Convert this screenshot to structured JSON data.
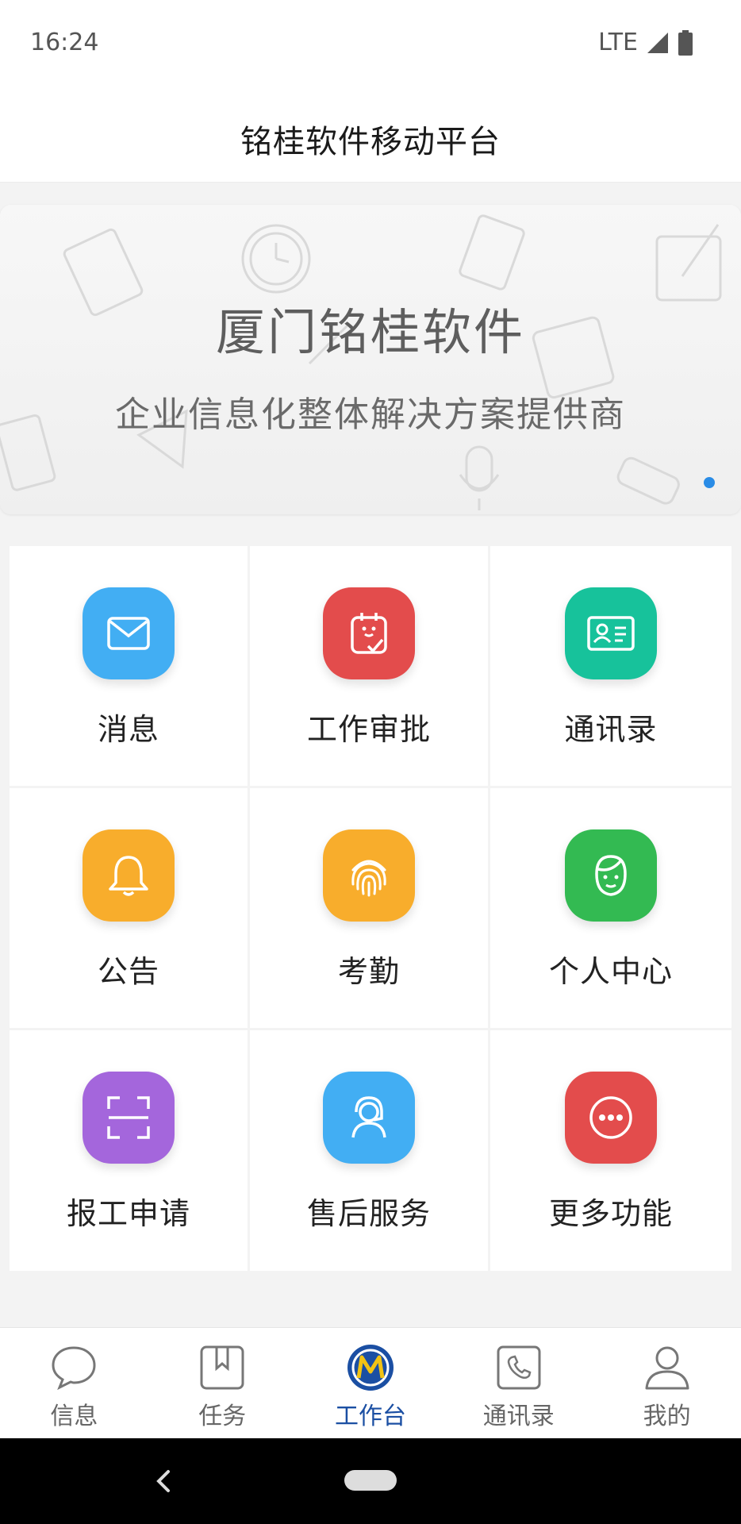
{
  "status_bar": {
    "time": "16:24",
    "network": "LTE"
  },
  "header": {
    "title": "铭桂软件移动平台"
  },
  "banner": {
    "title": "厦门铭桂软件",
    "subtitle": "企业信息化整体解决方案提供商"
  },
  "grid": [
    {
      "label": "消息",
      "icon": "envelope-icon",
      "color": "#42aef3"
    },
    {
      "label": "工作审批",
      "icon": "approval-icon",
      "color": "#e34c4c"
    },
    {
      "label": "通讯录",
      "icon": "contact-card-icon",
      "color": "#17c29b"
    },
    {
      "label": "公告",
      "icon": "bell-icon",
      "color": "#f8ad2c"
    },
    {
      "label": "考勤",
      "icon": "fingerprint-icon",
      "color": "#f8ad2c"
    },
    {
      "label": "个人中心",
      "icon": "user-face-icon",
      "color": "#33ba52"
    },
    {
      "label": "报工申请",
      "icon": "scan-icon",
      "color": "#a466dc"
    },
    {
      "label": "售后服务",
      "icon": "support-agent-icon",
      "color": "#42aef3"
    },
    {
      "label": "更多功能",
      "icon": "more-icon",
      "color": "#e34c4c"
    }
  ],
  "tabbar": [
    {
      "label": "信息",
      "icon": "chat-bubble-icon",
      "active": false
    },
    {
      "label": "任务",
      "icon": "bookmark-icon",
      "active": false
    },
    {
      "label": "工作台",
      "icon": "logo-m-icon",
      "active": true
    },
    {
      "label": "通讯录",
      "icon": "phone-icon",
      "active": false
    },
    {
      "label": "我的",
      "icon": "person-icon",
      "active": false
    }
  ],
  "colors": {
    "active_tab": "#1b4fa3",
    "indicator": "#2a8ce6"
  }
}
